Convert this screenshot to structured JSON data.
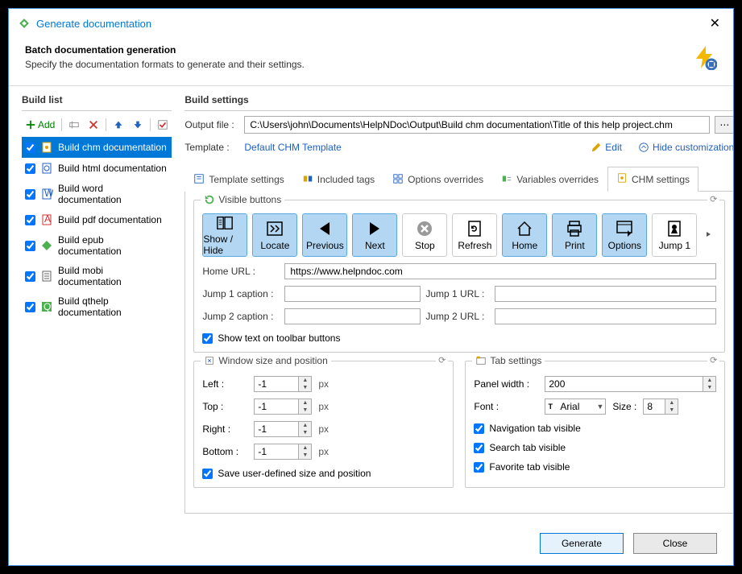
{
  "window": {
    "title": "Generate documentation",
    "close": "✕"
  },
  "header": {
    "title": "Batch documentation generation",
    "subtitle": "Specify the documentation formats to generate and their settings."
  },
  "sidebar": {
    "title": "Build list",
    "toolbar": {
      "add": "Add"
    },
    "items": [
      {
        "label": "Build chm documentation",
        "checked": true,
        "selected": true,
        "color": "#d9a300"
      },
      {
        "label": "Build html documentation",
        "checked": true,
        "selected": false,
        "color": "#2060c0"
      },
      {
        "label": "Build word documentation",
        "checked": true,
        "selected": false,
        "color": "#2060c0"
      },
      {
        "label": "Build pdf documentation",
        "checked": true,
        "selected": false,
        "color": "#d32f2f"
      },
      {
        "label": "Build epub documentation",
        "checked": true,
        "selected": false,
        "color": "#4caf50"
      },
      {
        "label": "Build mobi documentation",
        "checked": true,
        "selected": false,
        "color": "#666"
      },
      {
        "label": "Build qthelp documentation",
        "checked": true,
        "selected": false,
        "color": "#4caf50"
      }
    ]
  },
  "settings": {
    "title": "Build settings",
    "output_label": "Output file :",
    "output_value": "C:\\Users\\john\\Documents\\HelpNDoc\\Output\\Build chm documentation\\Title of this help project.chm",
    "template_label": "Template :",
    "template_value": "Default CHM Template",
    "edit": "Edit",
    "hide": "Hide customization",
    "tabs": [
      {
        "label": "Template settings"
      },
      {
        "label": "Included tags"
      },
      {
        "label": "Options overrides"
      },
      {
        "label": "Variables overrides"
      },
      {
        "label": "CHM settings"
      }
    ],
    "visible_buttons": {
      "title": "Visible buttons",
      "items": [
        {
          "label": "Show / Hide",
          "sel": true
        },
        {
          "label": "Locate",
          "sel": true
        },
        {
          "label": "Previous",
          "sel": true
        },
        {
          "label": "Next",
          "sel": true
        },
        {
          "label": "Stop",
          "sel": false
        },
        {
          "label": "Refresh",
          "sel": false
        },
        {
          "label": "Home",
          "sel": true
        },
        {
          "label": "Print",
          "sel": true
        },
        {
          "label": "Options",
          "sel": true
        },
        {
          "label": "Jump 1",
          "sel": false
        }
      ],
      "home_url_label": "Home URL :",
      "home_url": "https://www.helpndoc.com",
      "jump1_caption_label": "Jump 1 caption :",
      "jump1_caption": "",
      "jump1_url_label": "Jump 1 URL :",
      "jump1_url": "",
      "jump2_caption_label": "Jump 2 caption :",
      "jump2_caption": "",
      "jump2_url_label": "Jump 2 URL :",
      "jump2_url": "",
      "show_text_label": "Show text on toolbar buttons"
    },
    "winpos": {
      "title": "Window size and position",
      "left_label": "Left :",
      "left": "-1",
      "top_label": "Top :",
      "top": "-1",
      "right_label": "Right :",
      "right": "-1",
      "bottom_label": "Bottom :",
      "bottom": "-1",
      "px": "px",
      "save_label": "Save user-defined size and position"
    },
    "tabset": {
      "title": "Tab settings",
      "panel_width_label": "Panel width :",
      "panel_width": "200",
      "font_label": "Font :",
      "font": "Arial",
      "size_label": "Size :",
      "size": "8",
      "nav_label": "Navigation tab visible",
      "search_label": "Search tab visible",
      "fav_label": "Favorite tab visible"
    }
  },
  "footer": {
    "generate": "Generate",
    "close": "Close"
  }
}
